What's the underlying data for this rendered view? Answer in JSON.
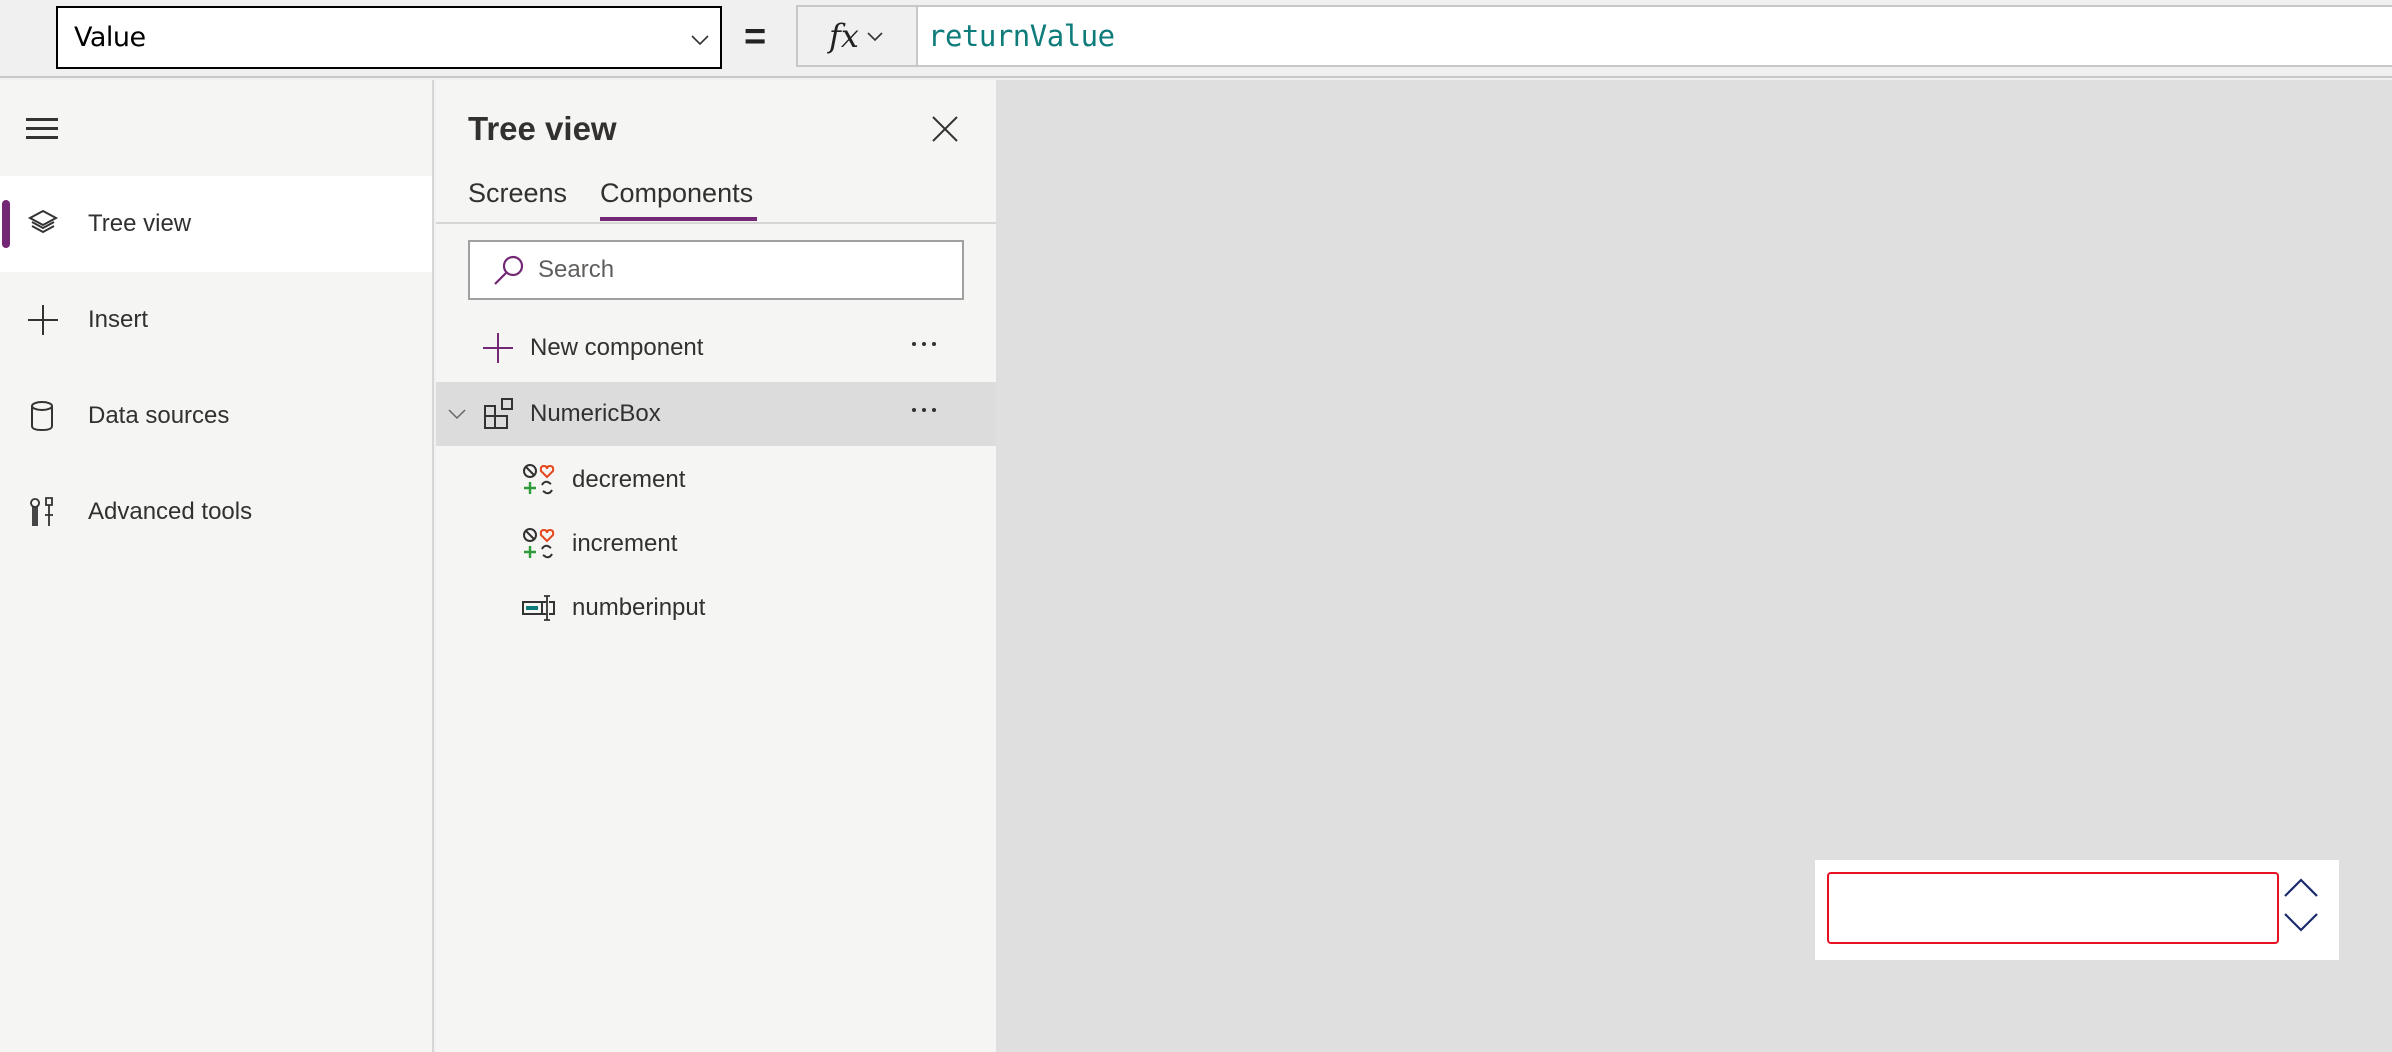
{
  "formula_bar": {
    "property": "Value",
    "equals": "=",
    "fx_label": "fx",
    "formula": "returnValue"
  },
  "left_nav": {
    "items": [
      {
        "label": "Tree view",
        "icon": "layers-icon",
        "active": true
      },
      {
        "label": "Insert",
        "icon": "plus-icon",
        "active": false
      },
      {
        "label": "Data sources",
        "icon": "database-icon",
        "active": false
      },
      {
        "label": "Advanced tools",
        "icon": "tools-icon",
        "active": false
      }
    ]
  },
  "tree_panel": {
    "title": "Tree view",
    "tabs": [
      {
        "label": "Screens",
        "active": false
      },
      {
        "label": "Components",
        "active": true
      }
    ],
    "search": {
      "placeholder": "Search",
      "value": ""
    },
    "new_component_label": "New component",
    "component": {
      "name": "NumericBox",
      "expanded": true,
      "children": [
        {
          "name": "decrement",
          "icon": "button-control-icon"
        },
        {
          "name": "increment",
          "icon": "button-control-icon"
        },
        {
          "name": "numberinput",
          "icon": "text-input-icon"
        }
      ]
    }
  },
  "canvas": {
    "numeric_box": {
      "value": "",
      "border_color": "#e81123",
      "arrow_color": "#1b2a6b"
    }
  },
  "colors": {
    "accent": "#742774",
    "formula_text": "#0e7c7b",
    "error_border": "#e81123"
  }
}
